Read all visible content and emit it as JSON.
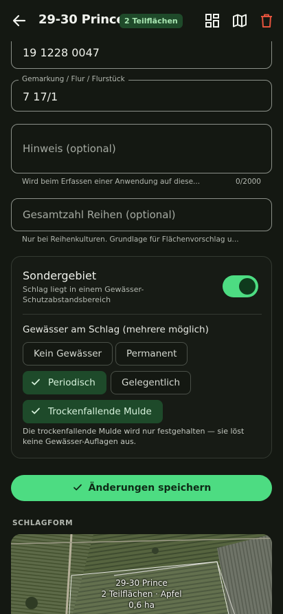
{
  "header": {
    "title": "29-30 Prince",
    "badge": "2 Teilflächen",
    "icons": [
      "arrow-back-icon",
      "dashboard-icon",
      "map-icon",
      "trash-icon"
    ]
  },
  "fields": {
    "flik": {
      "value": "19 1228 0047"
    },
    "gemarkung": {
      "label": "Gemarkung / Flur / Flurstück",
      "value": "7 17/1"
    },
    "hinweis": {
      "placeholder": "Hinweis (optional)",
      "helper": "Wird beim Erfassen einer Anwendung auf diese...",
      "counter": "0/2000"
    },
    "reihen": {
      "placeholder": "Gesamtzahl Reihen (optional)",
      "helper": "Nur bei Reihenkulturen. Grundlage für Flächenvorschlag u..."
    }
  },
  "sondergebiet": {
    "title": "Sondergebiet",
    "subtitle": "Schlag liegt in einem Gewässer-Schutzabstandsbereich",
    "enabled": true,
    "gewaesser_title": "Gewässer am Schlag (mehrere möglich)",
    "chips": [
      {
        "label": "Kein Gewässer",
        "selected": false
      },
      {
        "label": "Permanent",
        "selected": false
      },
      {
        "label": "Periodisch",
        "selected": true
      },
      {
        "label": "Gelegentlich",
        "selected": false
      },
      {
        "label": "Trockenfallende Mulde",
        "selected": true
      }
    ],
    "note": "Die trockenfallende Mulde wird nur festgehalten — sie löst keine Gewässer-Auflagen aus."
  },
  "save_label": "Änderungen speichern",
  "section_schlagform": "SCHLAGFORM",
  "map": {
    "name": "29-30 Prince",
    "detail": "2 Teilflächen · Apfel",
    "area": "0,6 ha"
  },
  "colors": {
    "accent": "#4ddc82",
    "chip_selected": "#1e4a2a",
    "danger": "#e5533d",
    "background": "#141812"
  }
}
